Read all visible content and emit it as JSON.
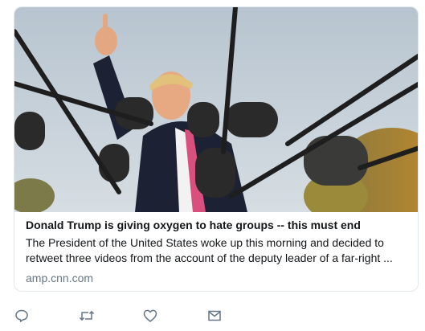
{
  "card": {
    "title": "Donald Trump is giving oxygen to hate groups -- this must end",
    "description": "The President of the United States woke up this morning and decided to retweet three videos from the account of the deputy leader of a far-right ...",
    "domain": "amp.cnn.com",
    "image_icon": "photo-microphones-press-gaggle"
  },
  "actions": [
    {
      "name": "reply",
      "icon": "reply-icon"
    },
    {
      "name": "retweet",
      "icon": "retweet-icon"
    },
    {
      "name": "like",
      "icon": "heart-icon"
    },
    {
      "name": "direct-message",
      "icon": "envelope-icon"
    }
  ],
  "colors": {
    "title": "#14171a",
    "domain": "#657786",
    "icon": "#657786",
    "border": "#e1e8ed"
  }
}
